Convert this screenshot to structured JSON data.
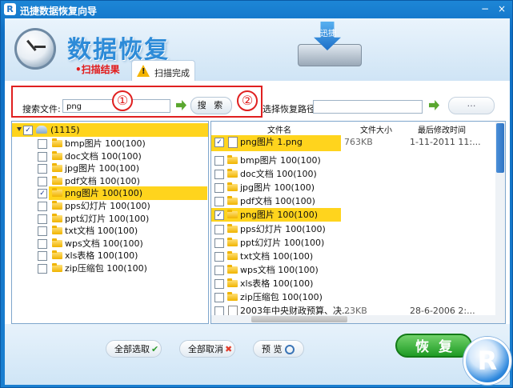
{
  "window": {
    "title": "迅捷数据恢复向导",
    "icon_letter": "R"
  },
  "header": {
    "big_title": "数据恢复",
    "drive_label": "迅捷",
    "tab_result": "•扫描结果",
    "tab_done": "扫描完成",
    "warn_glyph": "!"
  },
  "search": {
    "label": "搜索文件:",
    "value": "png",
    "button": "搜 索",
    "path_label": "选择恢复路径",
    "path_value": "",
    "browse_button": "…",
    "annotation_1": "①",
    "annotation_2": "②"
  },
  "tree": {
    "root": "(1115)",
    "items": [
      {
        "label": "bmp图片 100(100)",
        "checked": false
      },
      {
        "label": "doc文档 100(100)",
        "checked": false
      },
      {
        "label": "jpg图片 100(100)",
        "checked": false
      },
      {
        "label": "pdf文档 100(100)",
        "checked": false
      },
      {
        "label": "png图片 100(100)",
        "checked": true,
        "highlight": true
      },
      {
        "label": "pps幻灯片 100(100)",
        "checked": false
      },
      {
        "label": "ppt幻灯片 100(100)",
        "checked": false
      },
      {
        "label": "txt文档 100(100)",
        "checked": false
      },
      {
        "label": "wps文档 100(100)",
        "checked": false
      },
      {
        "label": "xls表格 100(100)",
        "checked": false
      },
      {
        "label": "zip压缩包 100(100)",
        "checked": false
      }
    ]
  },
  "files": {
    "headers": {
      "name": "文件名",
      "size": "文件大小",
      "modified": "最后修改时间"
    },
    "rows": [
      {
        "name": "png图片 1.png",
        "size": "763KB",
        "modified": "1-11-2011 11:...",
        "checked": true,
        "type": "file",
        "highlight": true
      },
      {
        "name": "bmp图片 100(100)",
        "size": "",
        "modified": "",
        "checked": false,
        "type": "folder"
      },
      {
        "name": "doc文档 100(100)",
        "size": "",
        "modified": "",
        "checked": false,
        "type": "folder"
      },
      {
        "name": "jpg图片 100(100)",
        "size": "",
        "modified": "",
        "checked": false,
        "type": "folder"
      },
      {
        "name": "pdf文档 100(100)",
        "size": "",
        "modified": "",
        "checked": false,
        "type": "folder"
      },
      {
        "name": "png图片 100(100)",
        "size": "",
        "modified": "",
        "checked": true,
        "type": "folder",
        "highlight": true
      },
      {
        "name": "pps幻灯片 100(100)",
        "size": "",
        "modified": "",
        "checked": false,
        "type": "folder"
      },
      {
        "name": "ppt幻灯片 100(100)",
        "size": "",
        "modified": "",
        "checked": false,
        "type": "folder"
      },
      {
        "name": "txt文档 100(100)",
        "size": "",
        "modified": "",
        "checked": false,
        "type": "folder"
      },
      {
        "name": "wps文档 100(100)",
        "size": "",
        "modified": "",
        "checked": false,
        "type": "folder"
      },
      {
        "name": "xls表格 100(100)",
        "size": "",
        "modified": "",
        "checked": false,
        "type": "folder"
      },
      {
        "name": "zip压缩包 100(100)",
        "size": "",
        "modified": "",
        "checked": false,
        "type": "folder"
      },
      {
        "name": "2003年中央财政预算、决...",
        "size": "23KB",
        "modified": "28-6-2006 2:...",
        "checked": false,
        "type": "file"
      }
    ]
  },
  "footer": {
    "select_all": "全部选取",
    "deselect_all": "全部取消",
    "preview": "预 览",
    "recover": "恢复",
    "logo_letter": "R"
  },
  "colors": {
    "accent": "#1a7fd0",
    "highlight": "#ffd41d",
    "annotation": "#e02020",
    "recover": "#1e9b25"
  }
}
